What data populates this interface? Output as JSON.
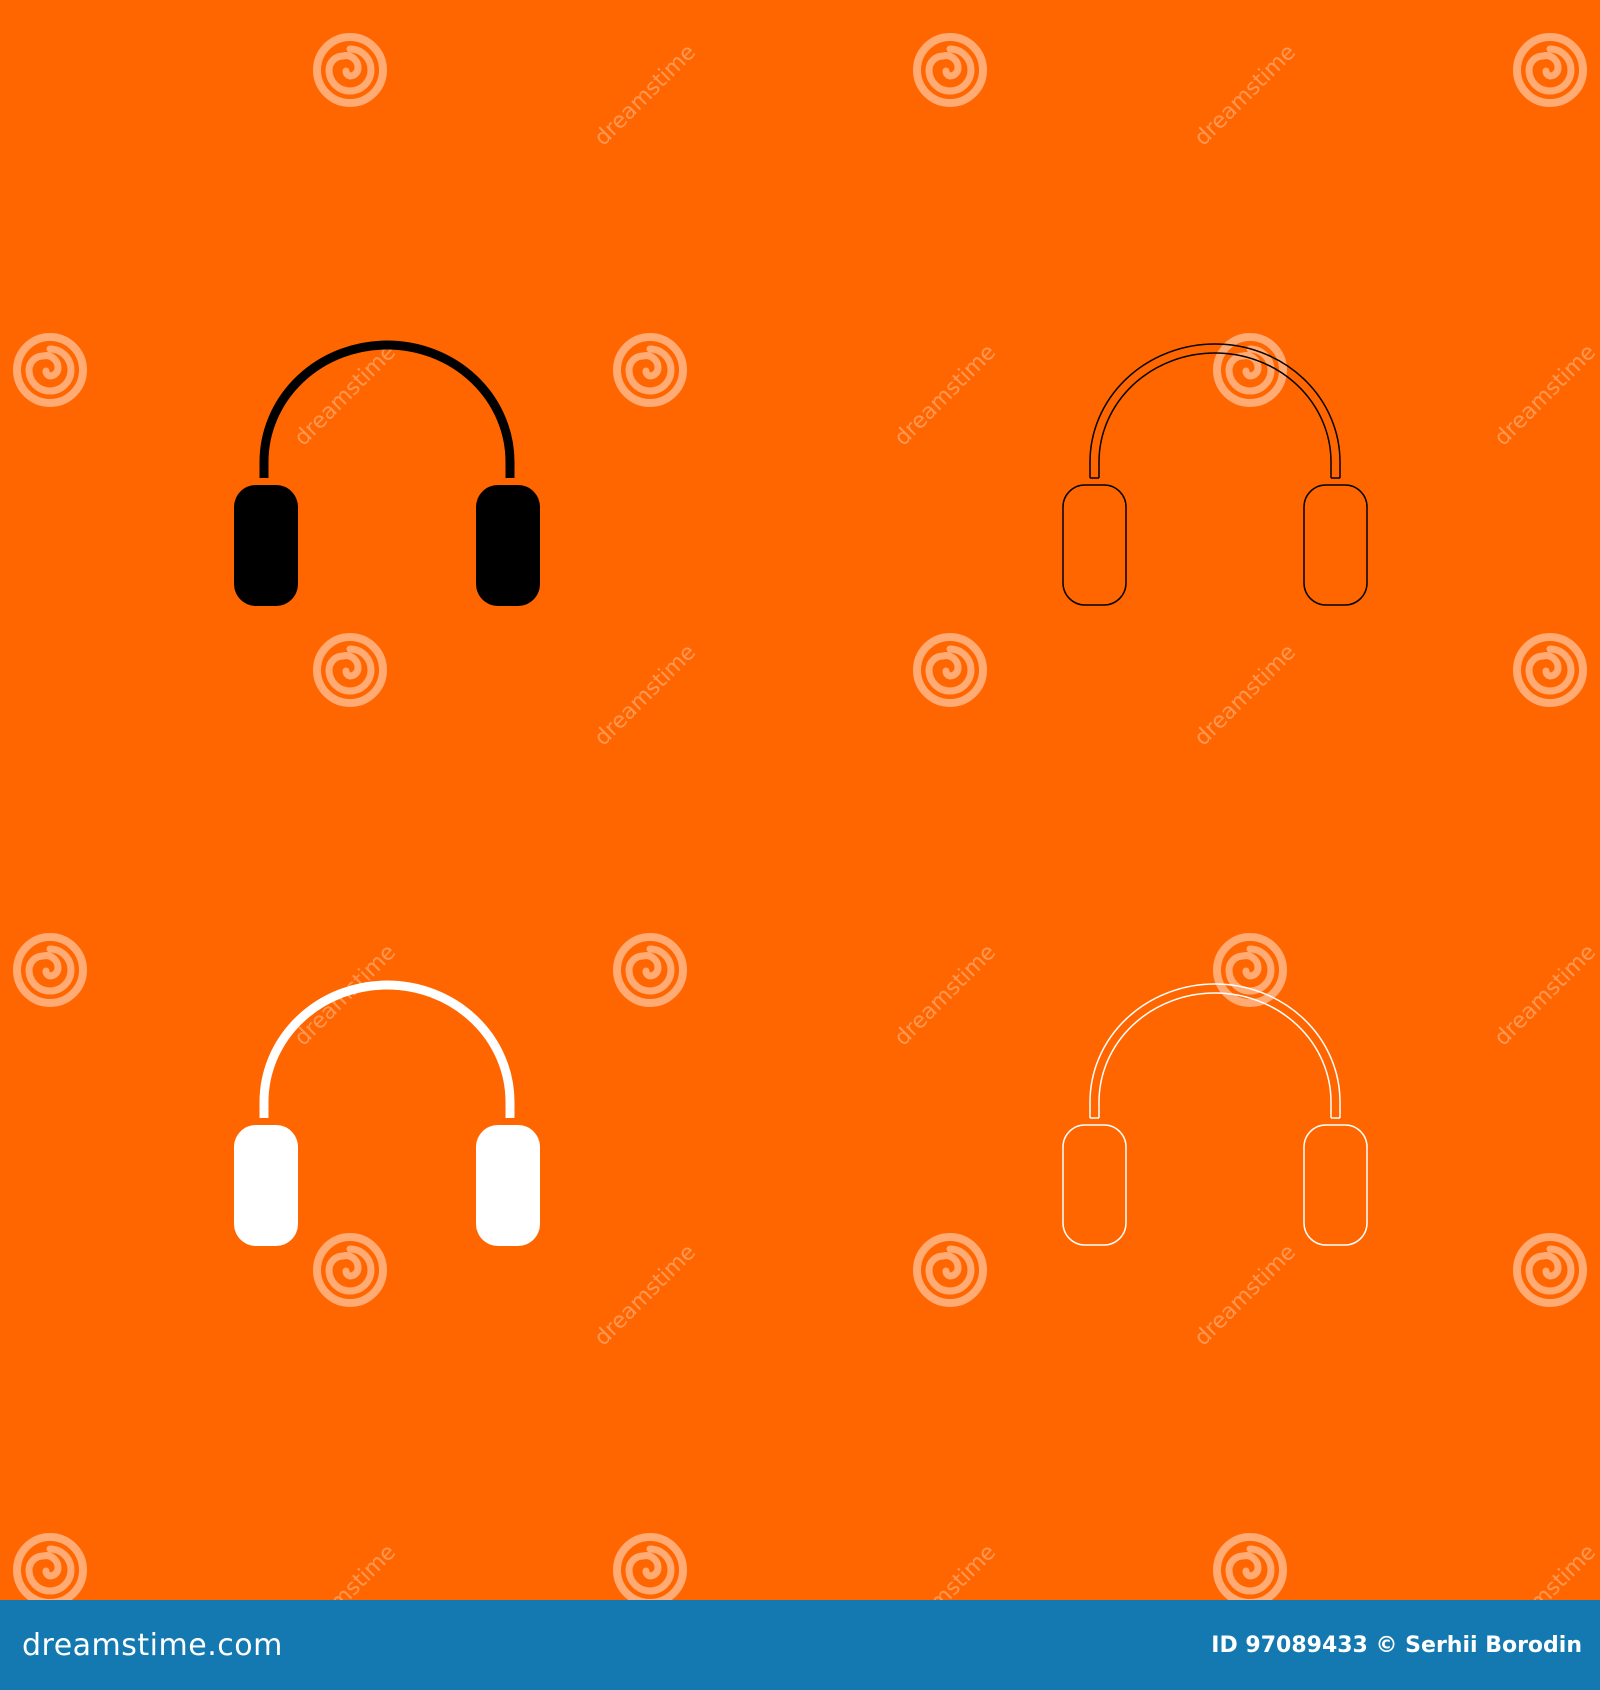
{
  "colors": {
    "background": "#ff6600",
    "footer": "#1479b0",
    "black_icon": "#000000",
    "white_icon": "#ffffff"
  },
  "icons": [
    {
      "name": "headphones-icon",
      "style": "solid",
      "color": "#000000"
    },
    {
      "name": "headphones-icon",
      "style": "outline",
      "color": "#000000"
    },
    {
      "name": "headphones-icon",
      "style": "solid",
      "color": "#ffffff"
    },
    {
      "name": "headphones-icon",
      "style": "outline",
      "color": "#ffffff"
    }
  ],
  "watermark": {
    "text": "dreamstime",
    "logo": "dreamstime-spiral-logo"
  },
  "footer": {
    "brand": "dreamstime.com",
    "credit": "ID 97089433 © Serhii Borodin"
  }
}
